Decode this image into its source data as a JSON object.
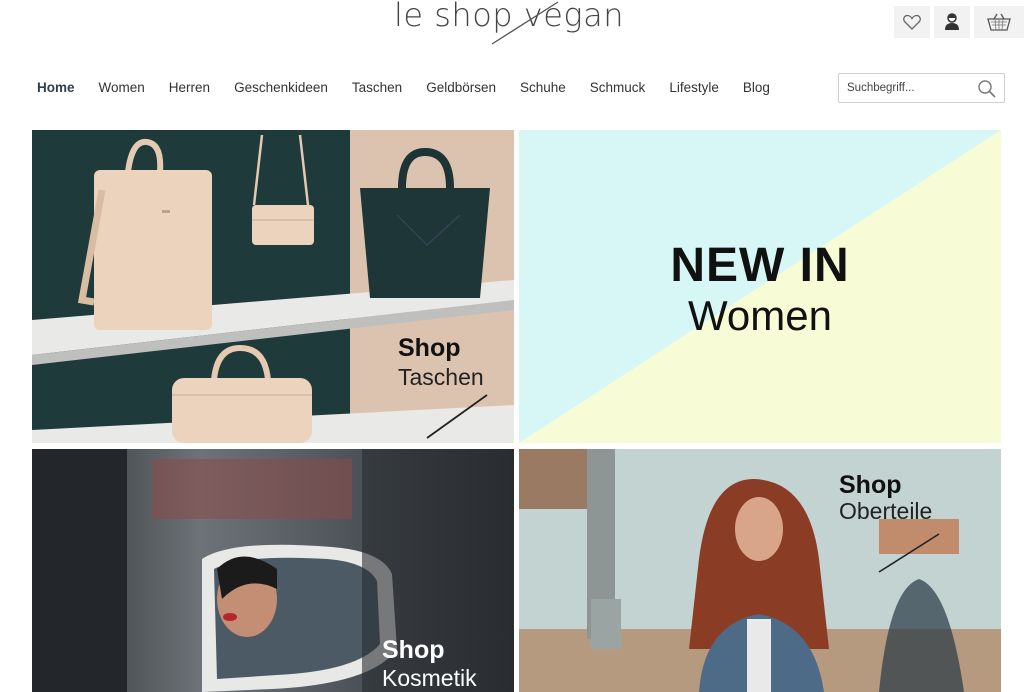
{
  "logo": {
    "text": "le shop vegan"
  },
  "header_icons": [
    "heart-icon",
    "user-icon",
    "basket-icon"
  ],
  "nav": {
    "items": [
      {
        "label": "Home",
        "active": true
      },
      {
        "label": "Women"
      },
      {
        "label": "Herren"
      },
      {
        "label": "Geschenkideen"
      },
      {
        "label": "Taschen"
      },
      {
        "label": "Geldbörsen"
      },
      {
        "label": "Schuhe"
      },
      {
        "label": "Schmuck"
      },
      {
        "label": "Lifestyle"
      },
      {
        "label": "Blog"
      }
    ]
  },
  "search": {
    "placeholder": "Suchbegriff..."
  },
  "tiles": {
    "taschen": {
      "line1": "Shop",
      "line2": "Taschen"
    },
    "newin": {
      "line1": "NEW IN",
      "line2": "Women"
    },
    "kosmetik": {
      "line1": "Shop",
      "line2": "Kosmetik"
    },
    "oberteile": {
      "line1": "Shop",
      "line2": "Oberteile"
    }
  },
  "colors": {
    "accent": "#2d3e50",
    "pastel_blue": "#d7f7f7",
    "pastel_yellow": "#f7fcd7"
  }
}
